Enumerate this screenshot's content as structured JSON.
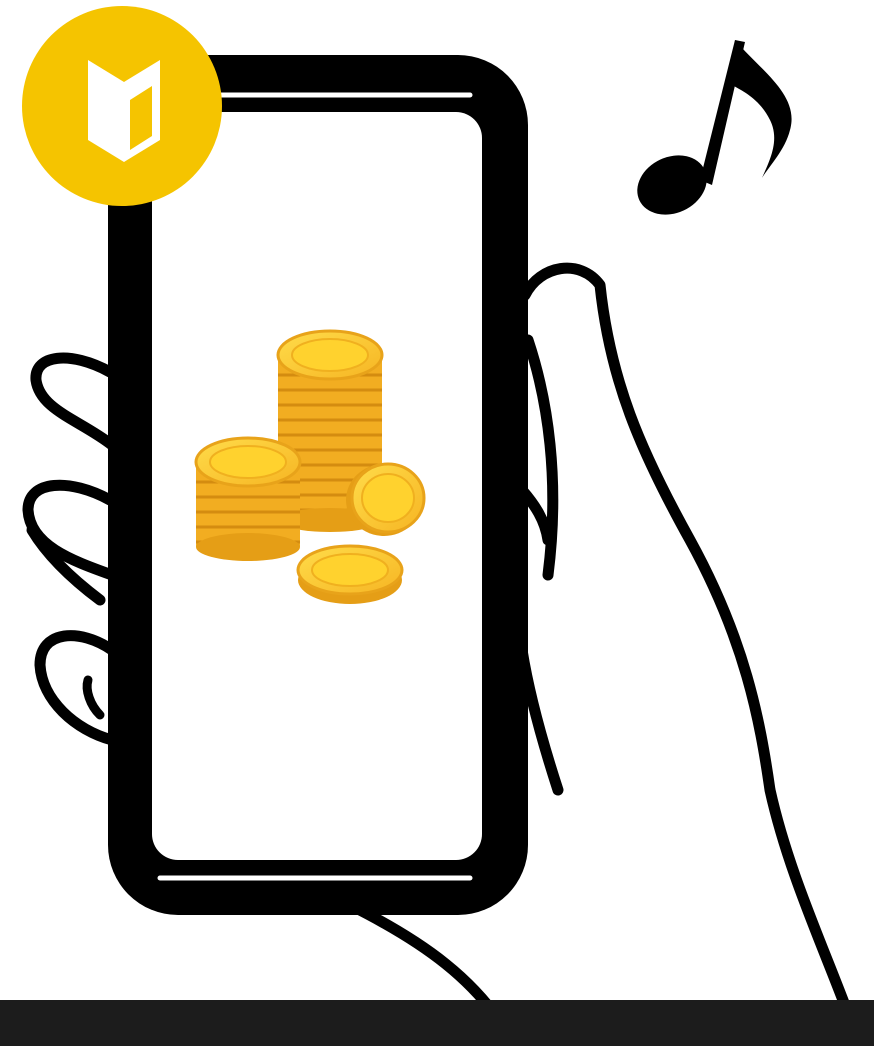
{
  "illustration": {
    "theme": "phone-in-hand-with-gold-coins",
    "icons": [
      "beginner-mark-icon",
      "music-note-icon",
      "coin-stack-icon",
      "smartphone-icon",
      "hand-icon"
    ]
  },
  "colors": {
    "background": "#ffffff",
    "outline": "#000000",
    "badge": "#f5c400",
    "coin_light": "#ffd633",
    "coin_mid": "#f7b928",
    "coin_dark": "#e09a12",
    "coin_edge": "#c57f0c",
    "bottom_bar": "#1c1c1c"
  }
}
